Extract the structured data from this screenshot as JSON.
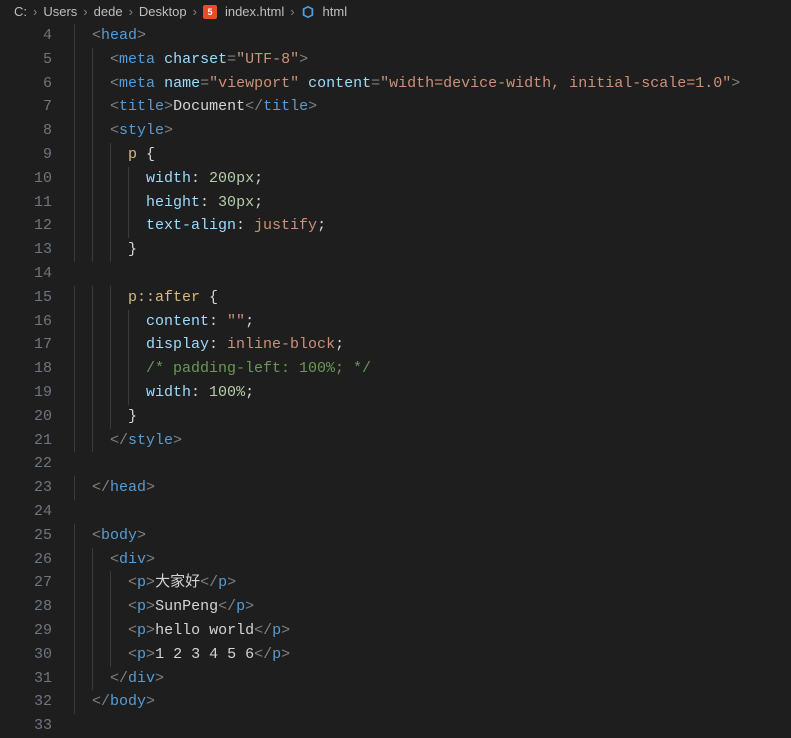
{
  "breadcrumb": {
    "segs": [
      "C:",
      "Users",
      "dede",
      "Desktop"
    ],
    "file": "index.html",
    "symbol": "html"
  },
  "lineStart": 4,
  "lineEnd": 33,
  "code": {
    "l4": {
      "indent": 1,
      "tokens": [
        [
          "brk",
          "<"
        ],
        [
          "tag",
          "head"
        ],
        [
          "brk",
          ">"
        ]
      ]
    },
    "l5": {
      "indent": 2,
      "tokens": [
        [
          "brk",
          "<"
        ],
        [
          "tag",
          "meta"
        ],
        [
          "text",
          " "
        ],
        [
          "attr",
          "charset"
        ],
        [
          "brk",
          "="
        ],
        [
          "str",
          "\"UTF-8\""
        ],
        [
          "brk",
          ">"
        ]
      ]
    },
    "l6": {
      "indent": 2,
      "tokens": [
        [
          "brk",
          "<"
        ],
        [
          "tag",
          "meta"
        ],
        [
          "text",
          " "
        ],
        [
          "attr",
          "name"
        ],
        [
          "brk",
          "="
        ],
        [
          "str",
          "\"viewport\""
        ],
        [
          "text",
          " "
        ],
        [
          "attr",
          "content"
        ],
        [
          "brk",
          "="
        ],
        [
          "str",
          "\"width=device-width, initial-scale=1.0\""
        ],
        [
          "brk",
          ">"
        ]
      ]
    },
    "l7": {
      "indent": 2,
      "tokens": [
        [
          "brk",
          "<"
        ],
        [
          "tag",
          "title"
        ],
        [
          "brk",
          ">"
        ],
        [
          "text",
          "Document"
        ],
        [
          "brk",
          "</"
        ],
        [
          "tag",
          "title"
        ],
        [
          "brk",
          ">"
        ]
      ]
    },
    "l8": {
      "indent": 2,
      "tokens": [
        [
          "brk",
          "<"
        ],
        [
          "tag",
          "style"
        ],
        [
          "brk",
          ">"
        ]
      ]
    },
    "l9": {
      "indent": 3,
      "tokens": [
        [
          "sel",
          "p"
        ],
        [
          "text",
          " "
        ],
        [
          "punc",
          "{"
        ]
      ]
    },
    "l10": {
      "indent": 4,
      "tokens": [
        [
          "prop",
          "width"
        ],
        [
          "punc",
          ": "
        ],
        [
          "num",
          "200"
        ],
        [
          "unit",
          "px"
        ],
        [
          "punc",
          ";"
        ]
      ]
    },
    "l11": {
      "indent": 4,
      "tokens": [
        [
          "prop",
          "height"
        ],
        [
          "punc",
          ": "
        ],
        [
          "num",
          "30"
        ],
        [
          "unit",
          "px"
        ],
        [
          "punc",
          ";"
        ]
      ]
    },
    "l12": {
      "indent": 4,
      "tokens": [
        [
          "prop",
          "text-align"
        ],
        [
          "punc",
          ": "
        ],
        [
          "val",
          "justify"
        ],
        [
          "punc",
          ";"
        ]
      ]
    },
    "l13": {
      "indent": 3,
      "tokens": [
        [
          "punc",
          "}"
        ]
      ]
    },
    "l14": {
      "indent": 0,
      "tokens": []
    },
    "l15": {
      "indent": 3,
      "tokens": [
        [
          "sel",
          "p::after"
        ],
        [
          "text",
          " "
        ],
        [
          "punc",
          "{"
        ]
      ]
    },
    "l16": {
      "indent": 4,
      "tokens": [
        [
          "prop",
          "content"
        ],
        [
          "punc",
          ": "
        ],
        [
          "str",
          "\"\""
        ],
        [
          "punc",
          ";"
        ]
      ]
    },
    "l17": {
      "indent": 4,
      "tokens": [
        [
          "prop",
          "display"
        ],
        [
          "punc",
          ": "
        ],
        [
          "val",
          "inline-block"
        ],
        [
          "punc",
          ";"
        ]
      ]
    },
    "l18": {
      "indent": 4,
      "tokens": [
        [
          "cmt",
          "/* padding-left: 100%; */"
        ]
      ]
    },
    "l19": {
      "indent": 4,
      "tokens": [
        [
          "prop",
          "width"
        ],
        [
          "punc",
          ": "
        ],
        [
          "num",
          "100"
        ],
        [
          "unit",
          "%"
        ],
        [
          "punc",
          ";"
        ]
      ]
    },
    "l20": {
      "indent": 3,
      "tokens": [
        [
          "punc",
          "}"
        ]
      ]
    },
    "l21": {
      "indent": 2,
      "tokens": [
        [
          "brk",
          "</"
        ],
        [
          "tag",
          "style"
        ],
        [
          "brk",
          ">"
        ]
      ]
    },
    "l22": {
      "indent": 0,
      "tokens": []
    },
    "l23": {
      "indent": 1,
      "tokens": [
        [
          "brk",
          "</"
        ],
        [
          "tag",
          "head"
        ],
        [
          "brk",
          ">"
        ]
      ]
    },
    "l24": {
      "indent": 0,
      "tokens": []
    },
    "l25": {
      "indent": 1,
      "tokens": [
        [
          "brk",
          "<"
        ],
        [
          "tag",
          "body"
        ],
        [
          "brk",
          ">"
        ]
      ]
    },
    "l26": {
      "indent": 2,
      "tokens": [
        [
          "brk",
          "<"
        ],
        [
          "tag",
          "div"
        ],
        [
          "brk",
          ">"
        ]
      ]
    },
    "l27": {
      "indent": 3,
      "tokens": [
        [
          "brk",
          "<"
        ],
        [
          "tag",
          "p"
        ],
        [
          "brk",
          ">"
        ],
        [
          "text",
          "大家好"
        ],
        [
          "brk",
          "</"
        ],
        [
          "tag",
          "p"
        ],
        [
          "brk",
          ">"
        ]
      ]
    },
    "l28": {
      "indent": 3,
      "tokens": [
        [
          "brk",
          "<"
        ],
        [
          "tag",
          "p"
        ],
        [
          "brk",
          ">"
        ],
        [
          "text",
          "SunPeng"
        ],
        [
          "brk",
          "</"
        ],
        [
          "tag",
          "p"
        ],
        [
          "brk",
          ">"
        ]
      ]
    },
    "l29": {
      "indent": 3,
      "tokens": [
        [
          "brk",
          "<"
        ],
        [
          "tag",
          "p"
        ],
        [
          "brk",
          ">"
        ],
        [
          "text",
          "hello world"
        ],
        [
          "brk",
          "</"
        ],
        [
          "tag",
          "p"
        ],
        [
          "brk",
          ">"
        ]
      ]
    },
    "l30": {
      "indent": 3,
      "tokens": [
        [
          "brk",
          "<"
        ],
        [
          "tag",
          "p"
        ],
        [
          "brk",
          ">"
        ],
        [
          "text",
          "1 2 3 4 5 6"
        ],
        [
          "brk",
          "</"
        ],
        [
          "tag",
          "p"
        ],
        [
          "brk",
          ">"
        ]
      ]
    },
    "l31": {
      "indent": 2,
      "tokens": [
        [
          "brk",
          "</"
        ],
        [
          "tag",
          "div"
        ],
        [
          "brk",
          ">"
        ]
      ]
    },
    "l32": {
      "indent": 1,
      "tokens": [
        [
          "brk",
          "</"
        ],
        [
          "tag",
          "body"
        ],
        [
          "brk",
          ">"
        ]
      ]
    },
    "l33": {
      "indent": 0,
      "tokens": []
    }
  }
}
